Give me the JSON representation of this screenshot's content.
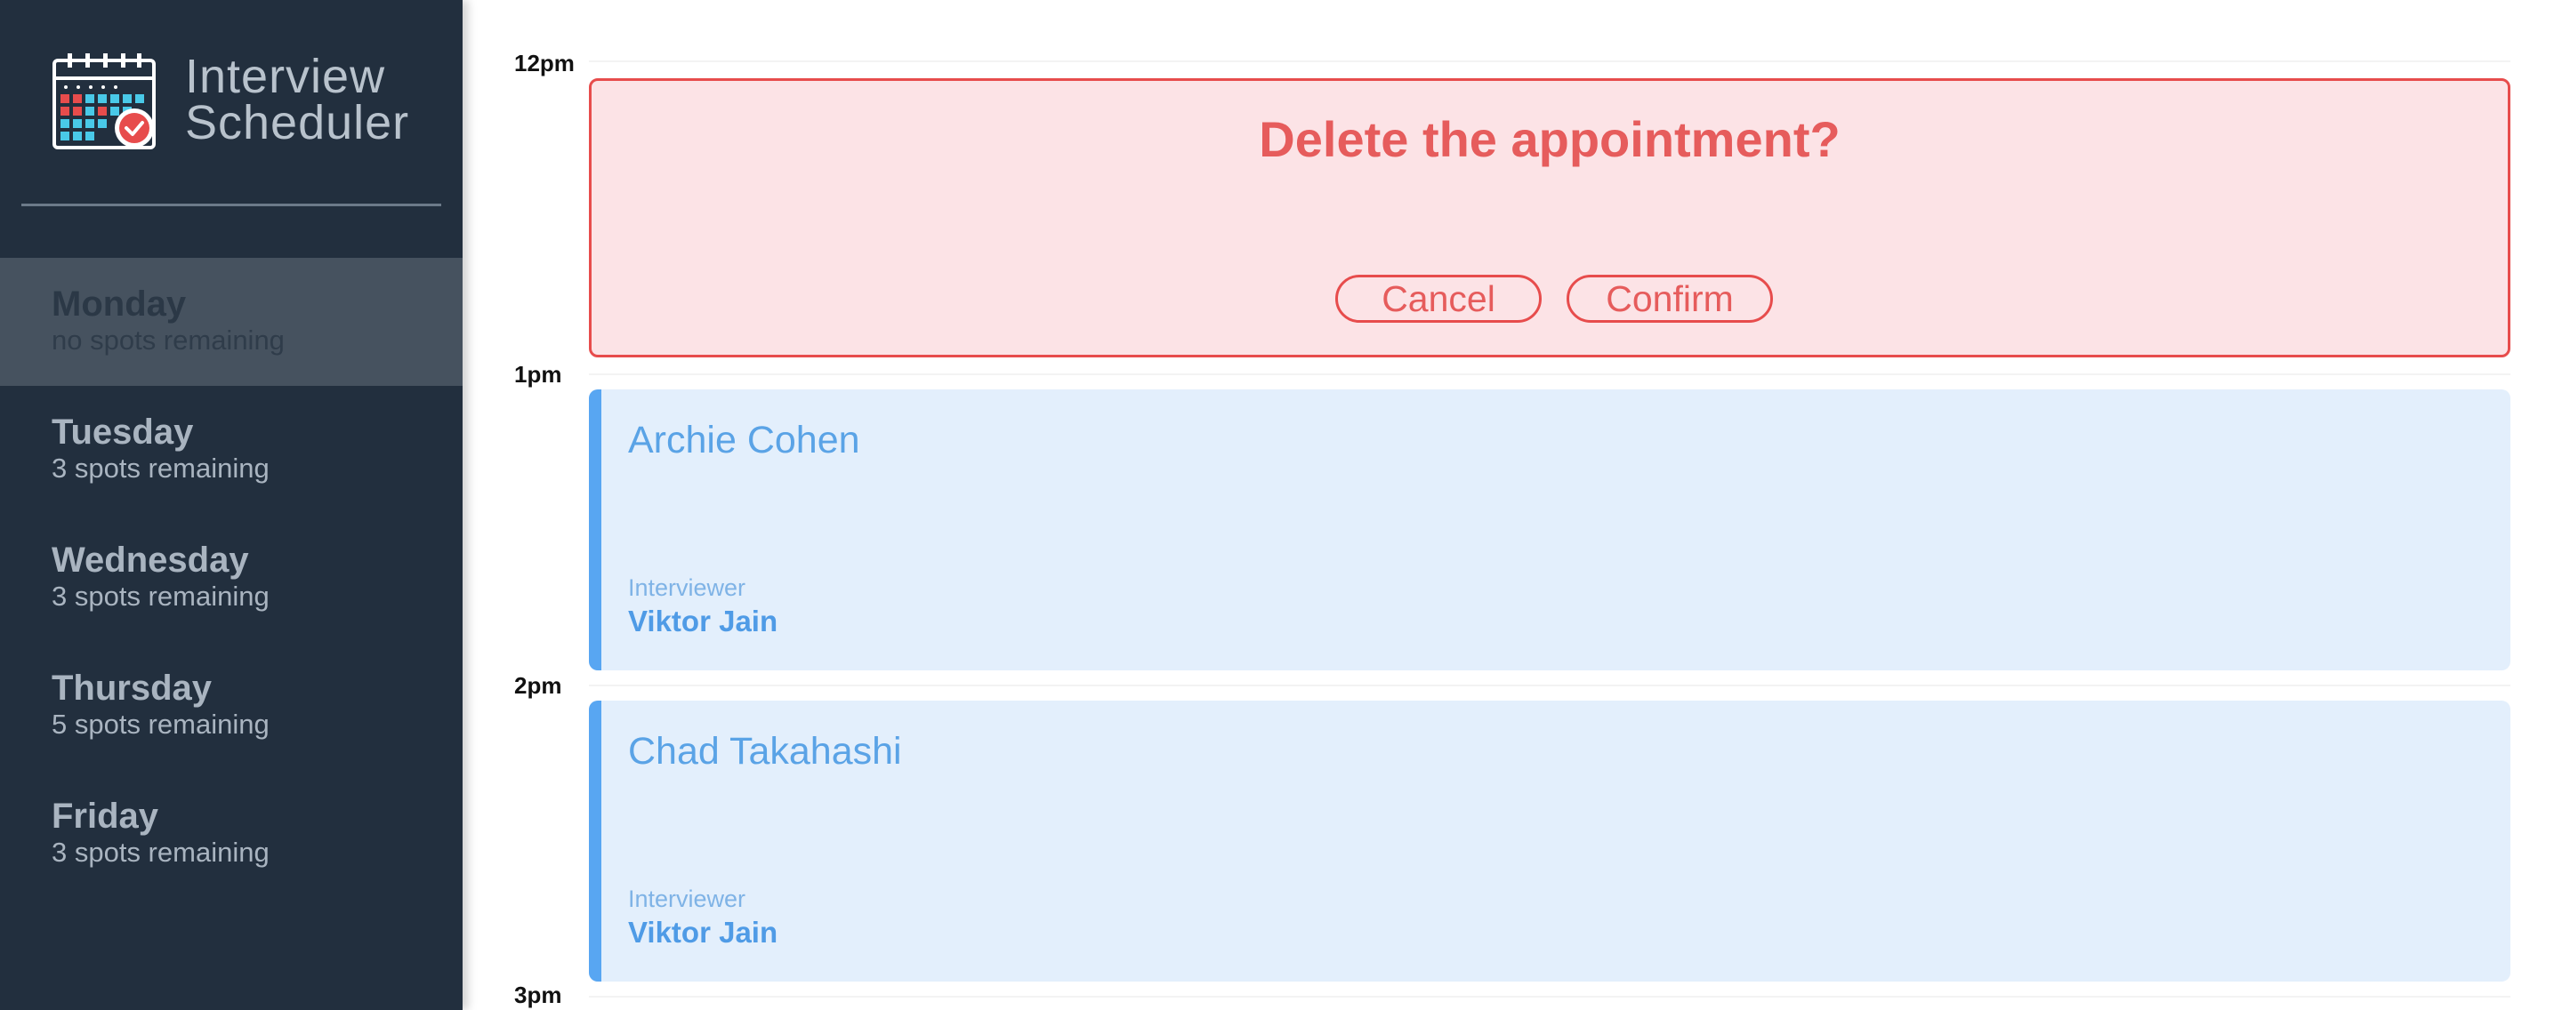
{
  "app": {
    "title_line1": "Interview",
    "title_line2": "Scheduler",
    "logo_icon": "calendar-check-icon"
  },
  "sidebar": {
    "days": [
      {
        "name": "Monday",
        "spots": "no spots remaining",
        "selected": true
      },
      {
        "name": "Tuesday",
        "spots": "3 spots remaining",
        "selected": false
      },
      {
        "name": "Wednesday",
        "spots": "3 spots remaining",
        "selected": false
      },
      {
        "name": "Thursday",
        "spots": "5 spots remaining",
        "selected": false
      },
      {
        "name": "Friday",
        "spots": "3 spots remaining",
        "selected": false
      }
    ]
  },
  "schedule": {
    "times": [
      "12pm",
      "1pm",
      "2pm",
      "3pm"
    ],
    "confirm": {
      "message": "Delete the appointment?",
      "cancel_label": "Cancel",
      "confirm_label": "Confirm"
    },
    "appointments": [
      {
        "student": "Archie Cohen",
        "interviewer_label": "Interviewer",
        "interviewer": "Viktor Jain"
      },
      {
        "student": "Chad Takahashi",
        "interviewer_label": "Interviewer",
        "interviewer": "Viktor Jain"
      }
    ]
  },
  "colors": {
    "sidebar_bg": "#222f3e",
    "selected_day_bg": "#46525f",
    "danger": "#e74c4c",
    "danger_bg": "#fce3e6",
    "card_bg": "#e3effc",
    "card_accent": "#58a6f2"
  }
}
